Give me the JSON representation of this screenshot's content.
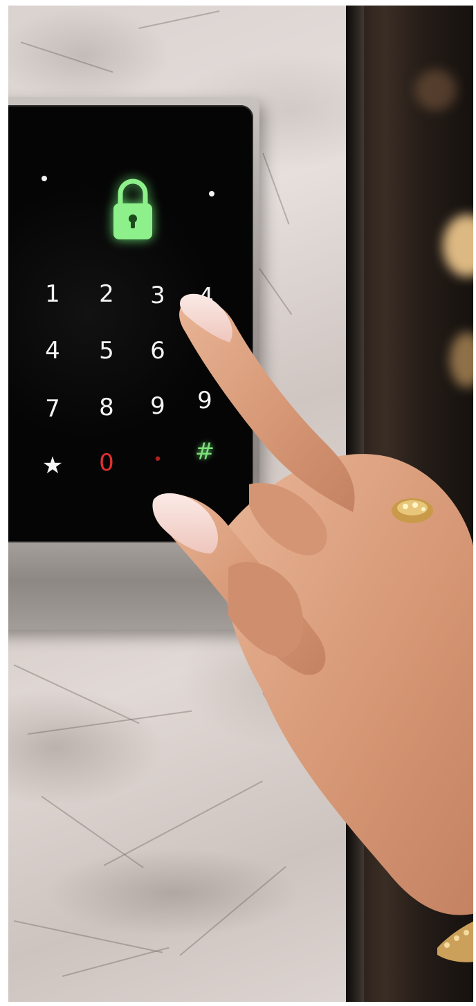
{
  "scene": {
    "subject": "",
    "colors": {
      "lock_glow": "#7ee07a",
      "zero_key": "#e03030",
      "hash_key": "#7ee07a",
      "glass": "#080808",
      "marble": "#ddd5d1"
    }
  },
  "keypad": {
    "status_icon": "lock-icon",
    "keys": {
      "k1": "1",
      "k2": "2",
      "k3": "3",
      "k4_top": "4",
      "k4": "4",
      "k5": "5",
      "k6": "6",
      "k7": "7",
      "k8": "8",
      "k9": "9",
      "k9_right": "9",
      "star": "★",
      "zero": "0",
      "dot": "•",
      "hash": "#"
    }
  }
}
